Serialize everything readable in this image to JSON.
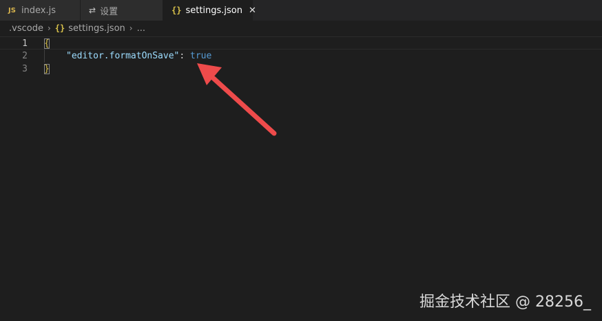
{
  "tabs": [
    {
      "icon": "JS",
      "label": "index.js"
    },
    {
      "icon": "⇄",
      "label": "设置"
    },
    {
      "icon": "{}",
      "label": "settings.json",
      "close": "✕"
    }
  ],
  "breadcrumb": {
    "folder": ".vscode",
    "file_icon": "{}",
    "file": "settings.json",
    "more": "..."
  },
  "editor": {
    "line_numbers": [
      "1",
      "2",
      "3"
    ],
    "line1": "{",
    "key": "\"editor.formatOnSave\"",
    "colon": ": ",
    "value": "true",
    "line3": "}"
  },
  "colors": {
    "key": "#9cdcfe",
    "boolean": "#569cd6",
    "brace": "#d8c14a",
    "arrow": "#ee4b4b"
  },
  "watermark": "掘金技术社区 @ 28256_"
}
